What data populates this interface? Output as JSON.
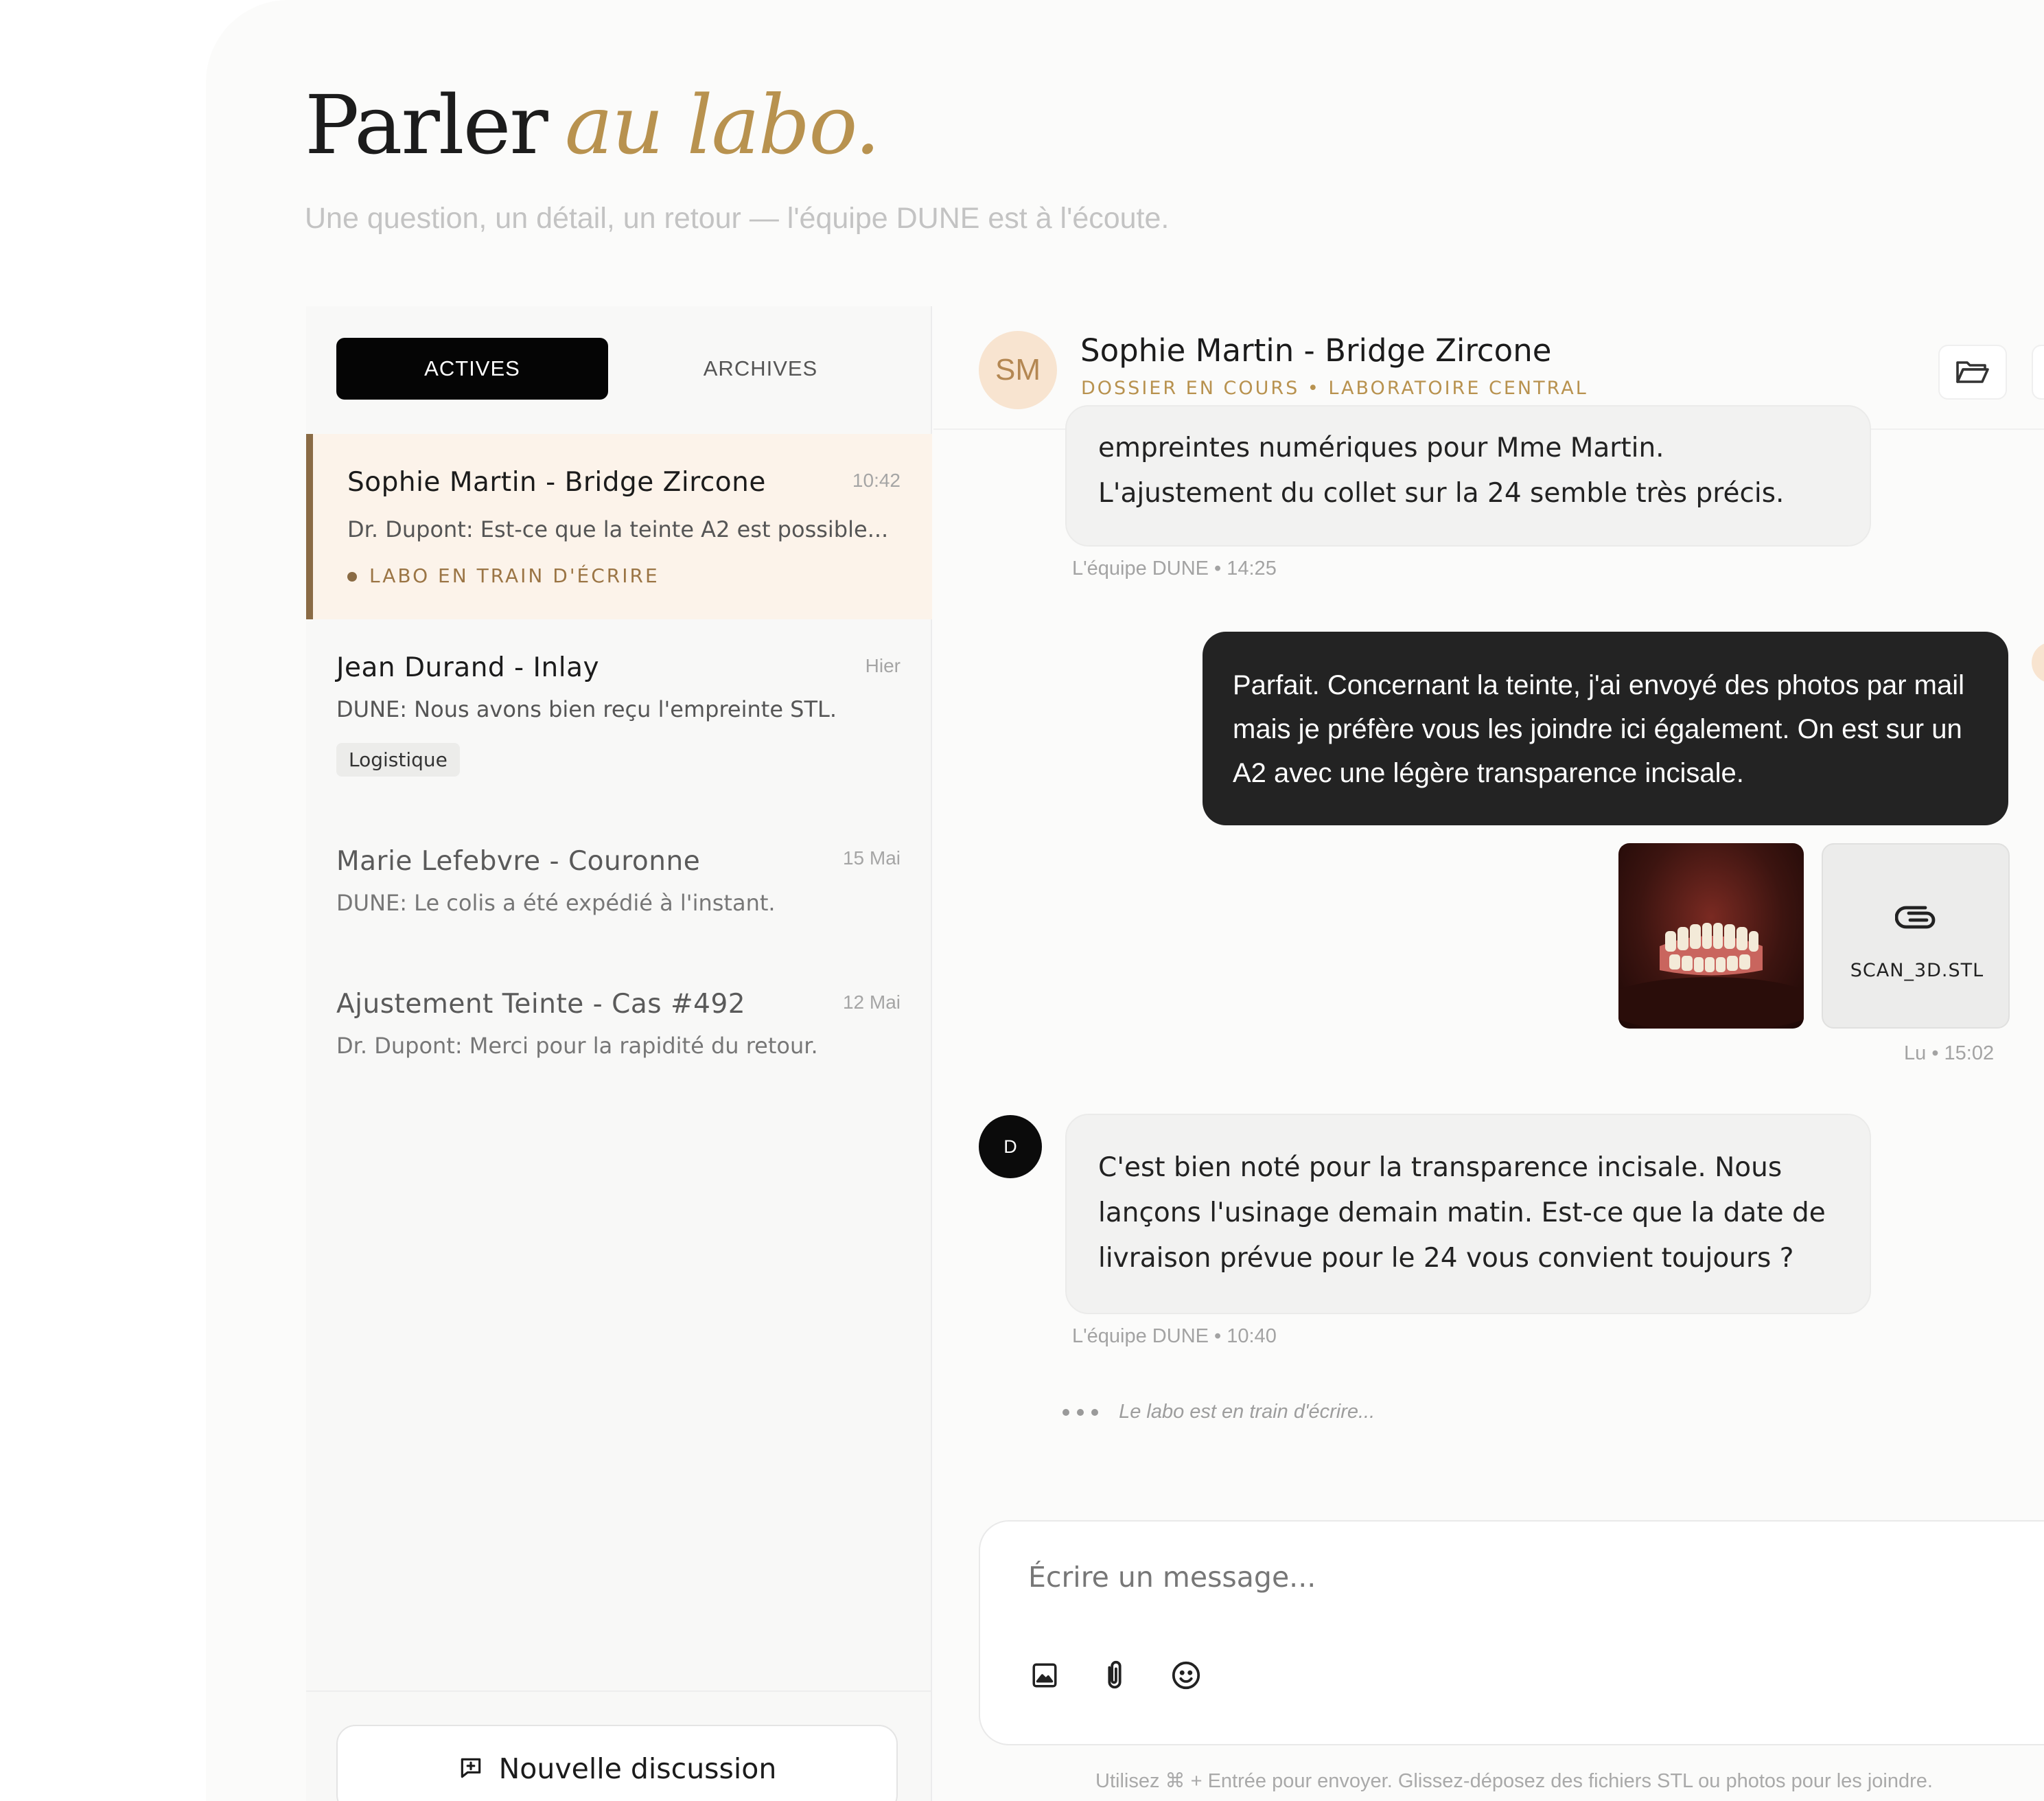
{
  "hero": {
    "title": "Parler",
    "title_accent": "au labo.",
    "subtitle": "Une question, un détail, un retour — l'équipe DUNE est à l'écoute."
  },
  "tabs": {
    "active": "ACTIVES",
    "archives": "ARCHIVES"
  },
  "conversations": [
    {
      "name": "Sophie Martin - Bridge Zircone",
      "time": "10:42",
      "preview": "Dr. Dupont: Est-ce que la teinte A2 est possible...",
      "status": "LABO EN TRAIN D'ÉCRIRE"
    },
    {
      "name": "Jean Durand - Inlay",
      "time": "Hier",
      "preview": "DUNE: Nous avons bien reçu l'empreinte STL.",
      "tag": "Logistique"
    },
    {
      "name": "Marie Lefebvre - Couronne",
      "time": "15 Mai",
      "preview": "DUNE: Le colis a été expédié à l'instant."
    },
    {
      "name": "Ajustement Teinte - Cas #492",
      "time": "12 Mai",
      "preview": "Dr. Dupont: Merci pour la rapidité du retour."
    }
  ],
  "new_discussion": "Nouvelle discussion",
  "chat": {
    "avatar_initials": "SM",
    "title": "Sophie Martin - Bridge Zircone",
    "subtitle": "DOSSIER EN COURS • LABORATOIRE CENTRAL",
    "messages": [
      {
        "text": "empreintes numériques pour Mme Martin. L'ajustement du collet sur la 24 semble très précis.",
        "meta": "L'équipe DUNE • 14:25"
      },
      {
        "text": "Parfait. Concernant la teinte, j'ai envoyé des photos par mail mais je préfère vous les joindre ici également. On est sur un A2 avec une légère transparence incisale.",
        "meta": "Lu • 15:02"
      },
      {
        "avatar": "D",
        "text": "C'est bien noté pour la transparence incisale. Nous lançons l'usinage demain matin. Est-ce que la date de livraison prévue pour le 24 vous convient toujours ?",
        "meta": "L'équipe DUNE • 10:40"
      }
    ],
    "attachment_file": "SCAN_3D.STL",
    "typing": "Le labo est en train d'écrire..."
  },
  "composer": {
    "placeholder": "Écrire un message...",
    "hint": "Utilisez ⌘ + Entrée pour envoyer. Glissez-déposez des fichiers STL ou photos pour les joindre."
  },
  "colors": {
    "accent": "#b8924f",
    "dark": "#232323",
    "selected_bg": "#fcf3ea"
  }
}
